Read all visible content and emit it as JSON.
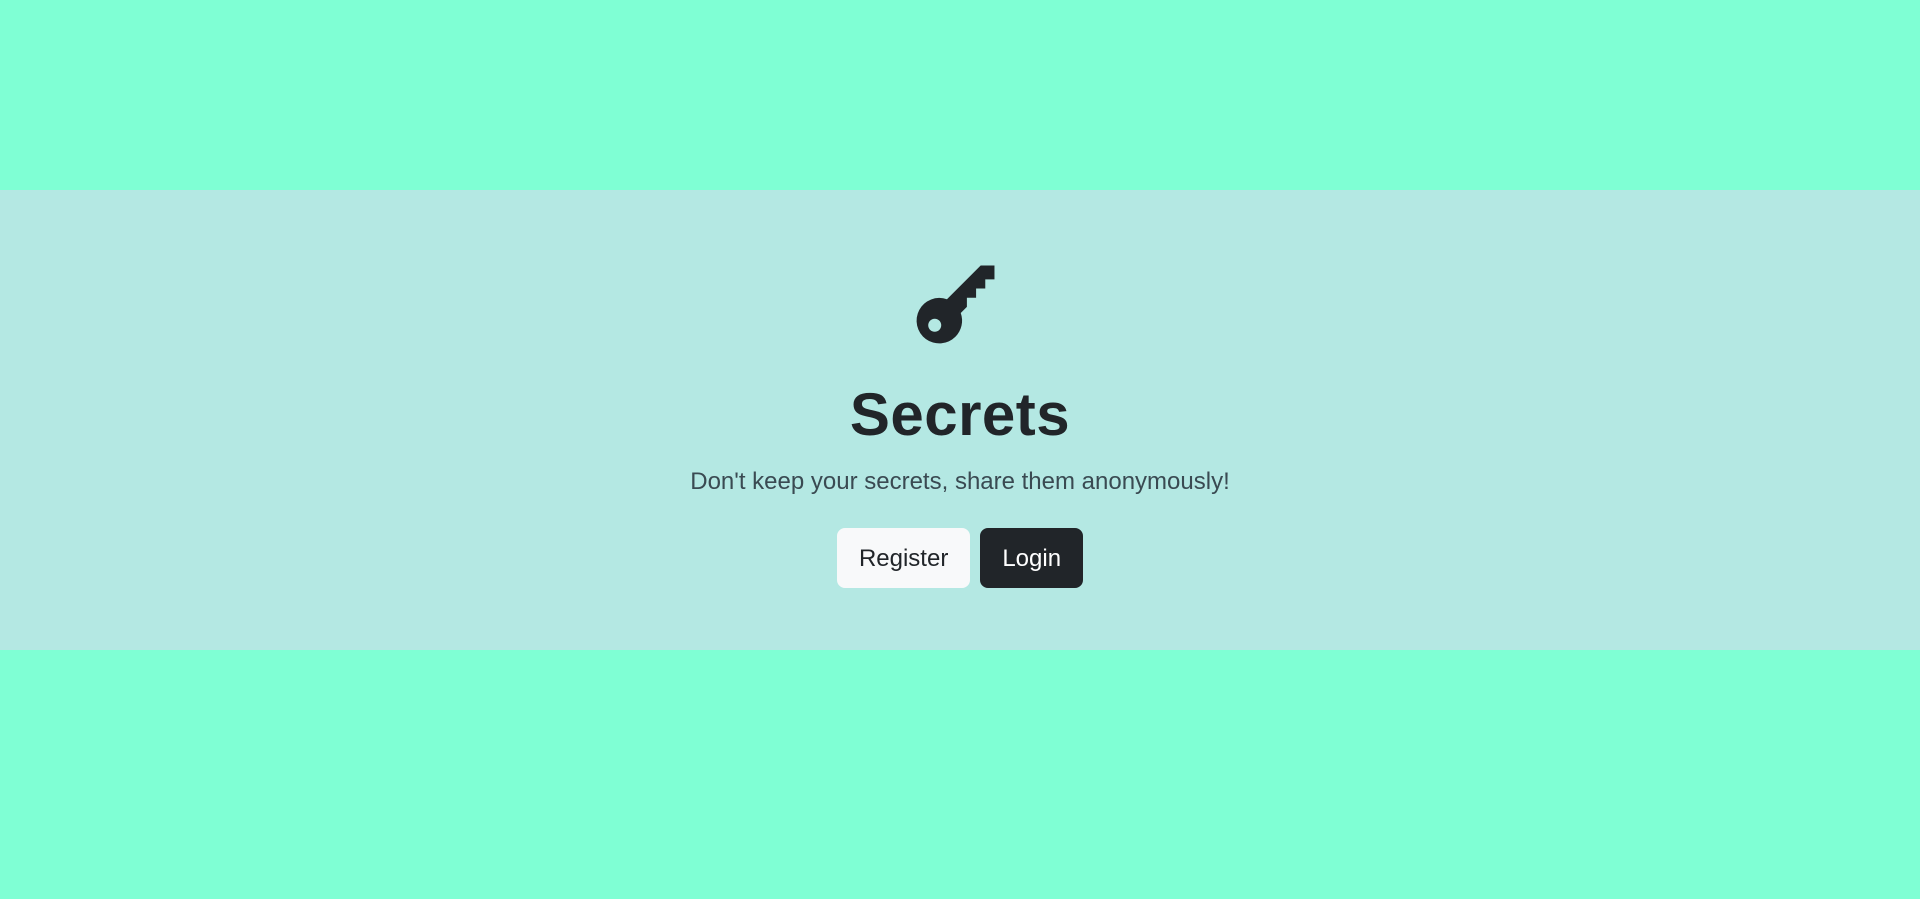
{
  "hero": {
    "icon": "key-icon",
    "title": "Secrets",
    "lead": "Don't keep your secrets, share them anonymously!",
    "register_label": "Register",
    "login_label": "Login"
  },
  "colors": {
    "page_background": "#7fffd4",
    "hero_background": "#b4e8e3",
    "text_dark": "#212529",
    "button_light": "#f8f9fa",
    "button_dark": "#212529"
  }
}
